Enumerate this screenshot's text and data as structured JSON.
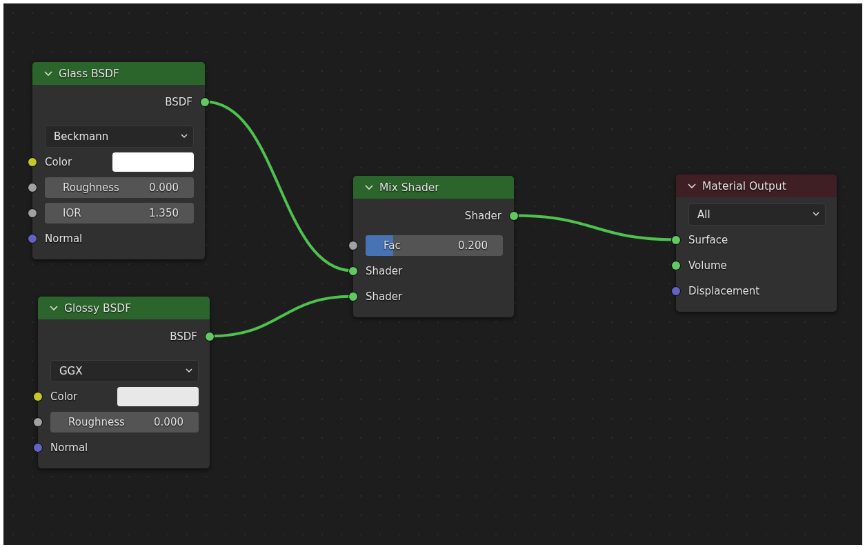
{
  "nodes": [
    {
      "title": "Glass BSDF",
      "kind": "shader",
      "rows": [
        {
          "kind": "output",
          "label": "BSDF",
          "socket": {
            "color": "#63c763"
          }
        },
        {
          "kind": "dropdown",
          "value": "Beckmann"
        },
        {
          "kind": "color",
          "label": "Color",
          "swatch": {
            "color": "#ffffff"
          },
          "socket": {
            "color": "#c7c729"
          }
        },
        {
          "kind": "number",
          "label": "Roughness",
          "value": "0.000",
          "socket": {
            "color": "#a1a1a1"
          }
        },
        {
          "kind": "number",
          "label": "IOR",
          "value": "1.350",
          "socket": {
            "color": "#a1a1a1"
          }
        },
        {
          "kind": "input",
          "label": "Normal",
          "socket": {
            "color": "#6363c7"
          }
        }
      ]
    },
    {
      "title": "Glossy BSDF",
      "kind": "shader",
      "rows": [
        {
          "kind": "output",
          "label": "BSDF",
          "socket": {
            "color": "#63c763"
          }
        },
        {
          "kind": "dropdown",
          "value": "GGX"
        },
        {
          "kind": "color",
          "label": "Color",
          "swatch": {
            "color": "#e8e8e8"
          },
          "socket": {
            "color": "#c7c729"
          }
        },
        {
          "kind": "number",
          "label": "Roughness",
          "value": "0.000",
          "socket": {
            "color": "#a1a1a1"
          }
        },
        {
          "kind": "input",
          "label": "Normal",
          "socket": {
            "color": "#6363c7"
          }
        }
      ]
    },
    {
      "title": "Mix Shader",
      "kind": "shader",
      "rows": [
        {
          "kind": "output",
          "label": "Shader",
          "socket": {
            "color": "#63c763"
          }
        },
        {
          "kind": "slider",
          "label": "Fac",
          "value": "0.200",
          "level": 0.2,
          "socket": {
            "color": "#a1a1a1"
          }
        },
        {
          "kind": "input",
          "label": "Shader",
          "socket": {
            "color": "#63c763"
          }
        },
        {
          "kind": "input",
          "label": "Shader",
          "socket": {
            "color": "#63c763"
          }
        }
      ]
    },
    {
      "title": "Material Output",
      "kind": "output",
      "rows": [
        {
          "kind": "dropdown",
          "value": "All"
        },
        {
          "kind": "input",
          "label": "Surface",
          "socket": {
            "color": "#63c763"
          }
        },
        {
          "kind": "input",
          "label": "Volume",
          "socket": {
            "color": "#63c763"
          }
        },
        {
          "kind": "input",
          "label": "Displacement",
          "socket": {
            "color": "#6363c7"
          }
        }
      ]
    }
  ]
}
